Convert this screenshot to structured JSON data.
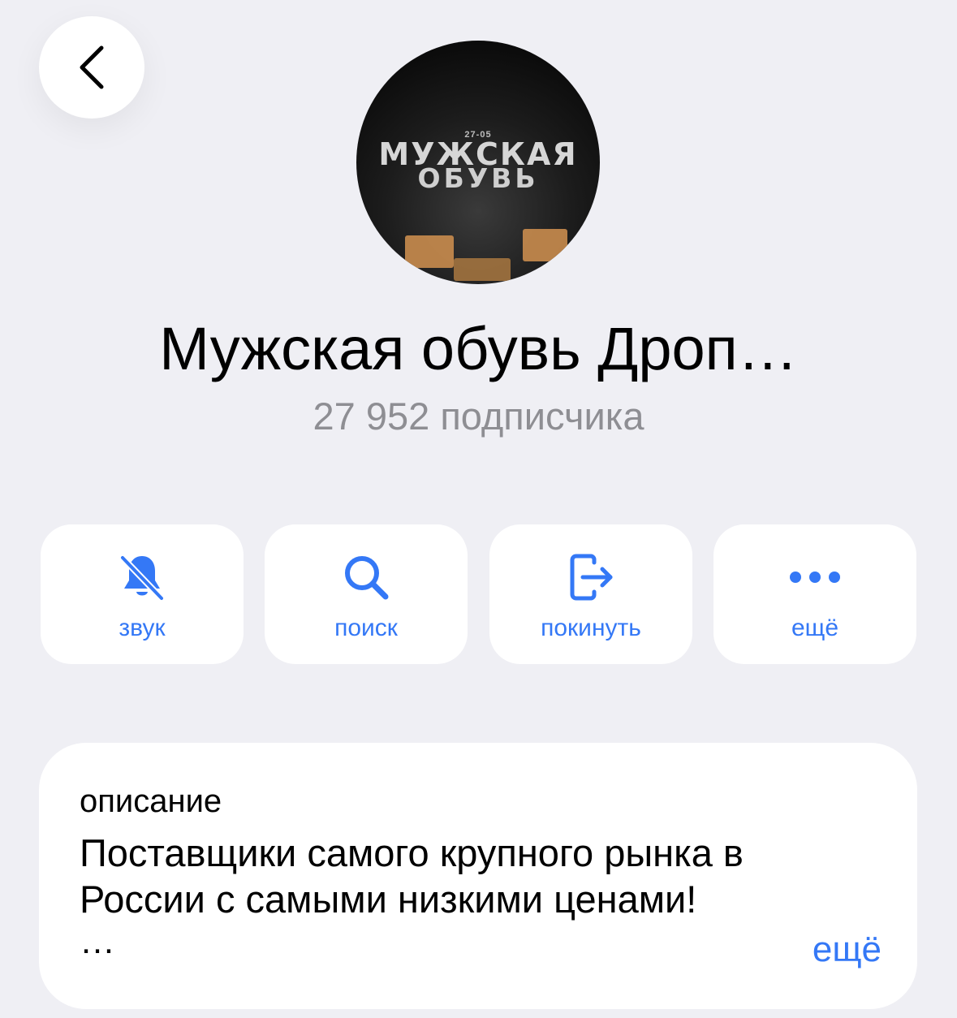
{
  "header": {
    "back_icon": "chevron-left-icon"
  },
  "avatar": {
    "date_text": "27-05",
    "line1": "МУЖСКАЯ",
    "line2": "ОБУВЬ"
  },
  "channel": {
    "title": "Мужская обувь Дроп…",
    "subscribers": "27 952 подписчика"
  },
  "actions": [
    {
      "label": "звук",
      "icon": "bell-slash-icon"
    },
    {
      "label": "поиск",
      "icon": "search-icon"
    },
    {
      "label": "покинуть",
      "icon": "leave-icon"
    },
    {
      "label": "ещё",
      "icon": "more-dots-icon"
    }
  ],
  "description": {
    "label": "описание",
    "text": "Поставщики самого крупного рынка в России с самыми низкими ценами!",
    "ellipsis": "…",
    "more_label": "ещё"
  },
  "colors": {
    "background": "#efeff4",
    "accent": "#3478f6",
    "secondary_text": "#8e8e93",
    "card": "#ffffff"
  }
}
